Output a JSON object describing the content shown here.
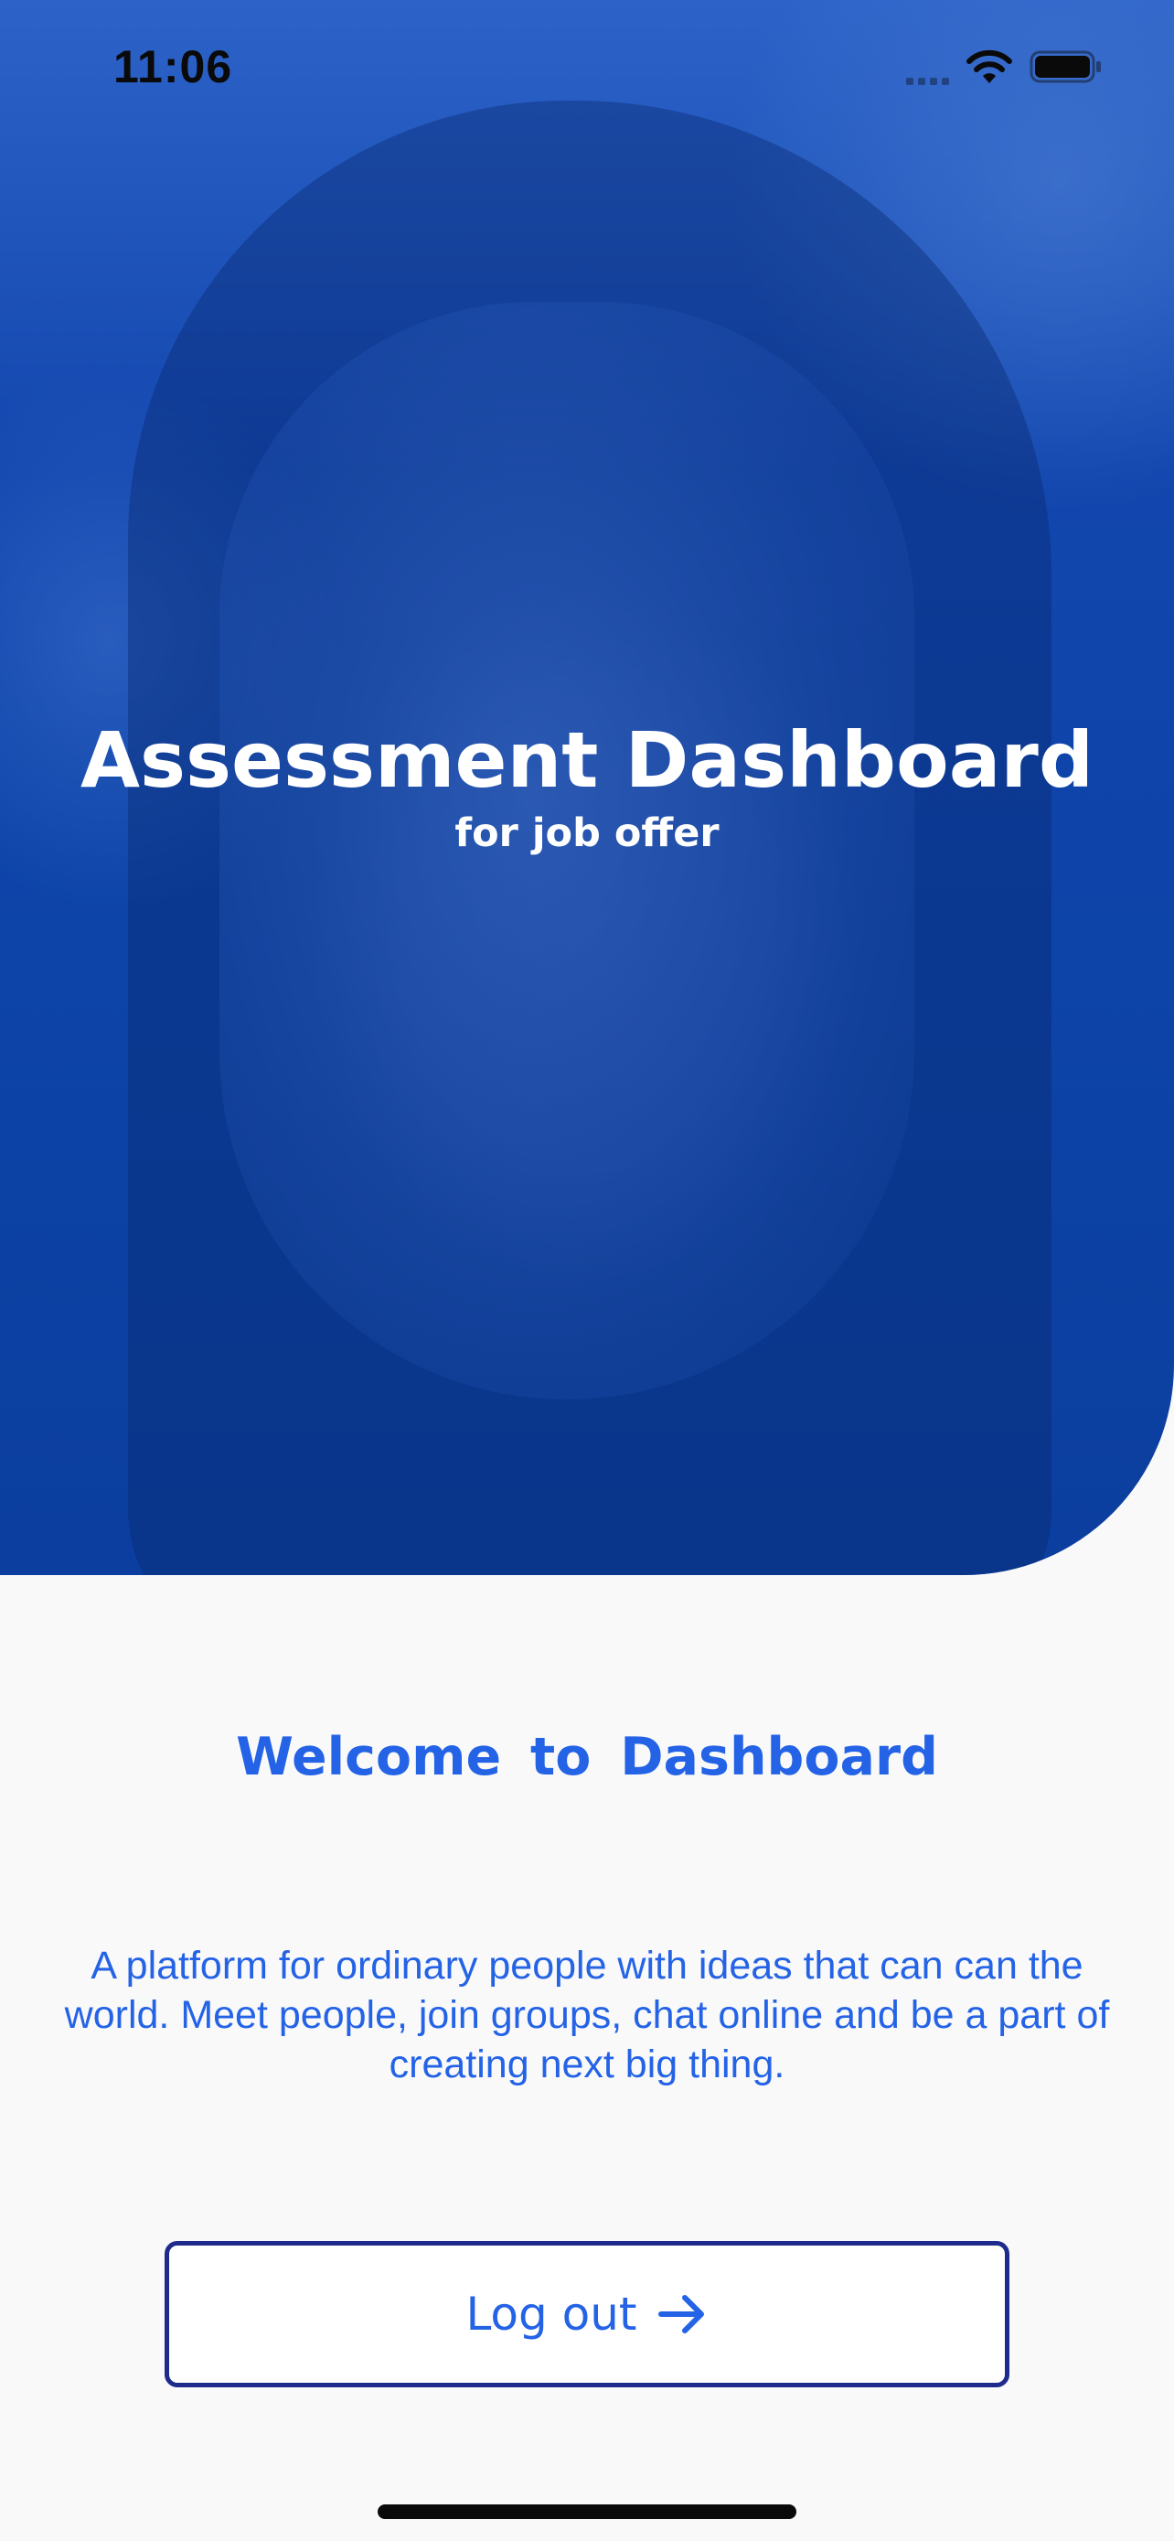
{
  "status_bar": {
    "time": "11:06",
    "icons": [
      "signal-icon",
      "wifi-icon",
      "battery-icon"
    ]
  },
  "hero": {
    "title": "Assessment Dashboard",
    "subtitle": "for job offer",
    "image": "portrait-photo",
    "tint_color": "#0D44A8"
  },
  "content": {
    "welcome": "Welcome  to  Dashboard",
    "description": "A platform for ordinary people with ideas that can can the world. Meet people, join groups, chat online and be a part of creating next big thing."
  },
  "logout": {
    "label": "Log out",
    "icon": "arrow-right-icon"
  },
  "colors": {
    "accent": "#2463E6",
    "button_border": "#1E2A8C",
    "background": "#F9F9F9"
  }
}
